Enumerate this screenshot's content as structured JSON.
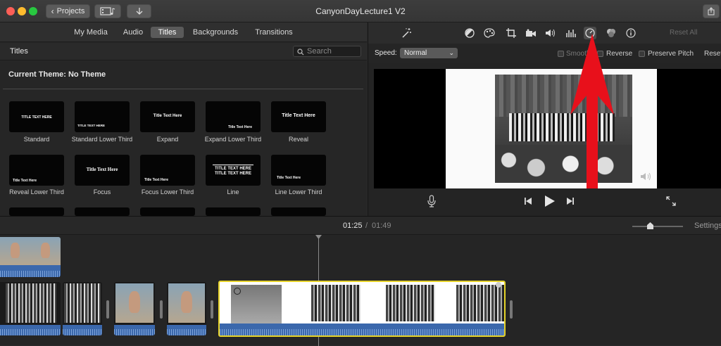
{
  "window": {
    "title": "CanyonDayLecture1 V2",
    "projects_button": "Projects"
  },
  "browser": {
    "tabs": [
      "My Media",
      "Audio",
      "Titles",
      "Backgrounds",
      "Transitions"
    ],
    "active_tab": "Titles",
    "section_title": "Titles",
    "search_placeholder": "Search",
    "theme_label": "Current Theme: No Theme",
    "tiles": [
      {
        "label": "Standard",
        "preview": "TITLE TEXT HERE"
      },
      {
        "label": "Standard Lower Third",
        "preview": "TITLE TEXT HERE"
      },
      {
        "label": "Expand",
        "preview": "Title Text Here"
      },
      {
        "label": "Expand Lower Third",
        "preview": "Title Text Here"
      },
      {
        "label": "Reveal",
        "preview": "Title Text Here"
      },
      {
        "label": "Reveal Lower Third",
        "preview": "Title Text Here"
      },
      {
        "label": "Focus",
        "preview": "Title Text Here"
      },
      {
        "label": "Focus Lower Third",
        "preview": "Title Text Here"
      },
      {
        "label": "Line",
        "preview": "TITLE TEXT HERE"
      },
      {
        "label": "Line Lower Third",
        "preview": "Title Text Here"
      }
    ]
  },
  "viewer": {
    "reset_all": "Reset All",
    "speed_label": "Speed:",
    "speed_value": "Normal",
    "smooth": "Smooth",
    "reverse": "Reverse",
    "preserve_pitch": "Preserve Pitch",
    "reset": "Reset"
  },
  "timeline": {
    "current_time": "01:25",
    "separator": "/",
    "total_time": "01:49",
    "settings": "Settings"
  },
  "colors": {
    "annotation_arrow": "#e8101b",
    "selection_border": "#e6d32a",
    "audio_waveform": "#3b68ac"
  }
}
